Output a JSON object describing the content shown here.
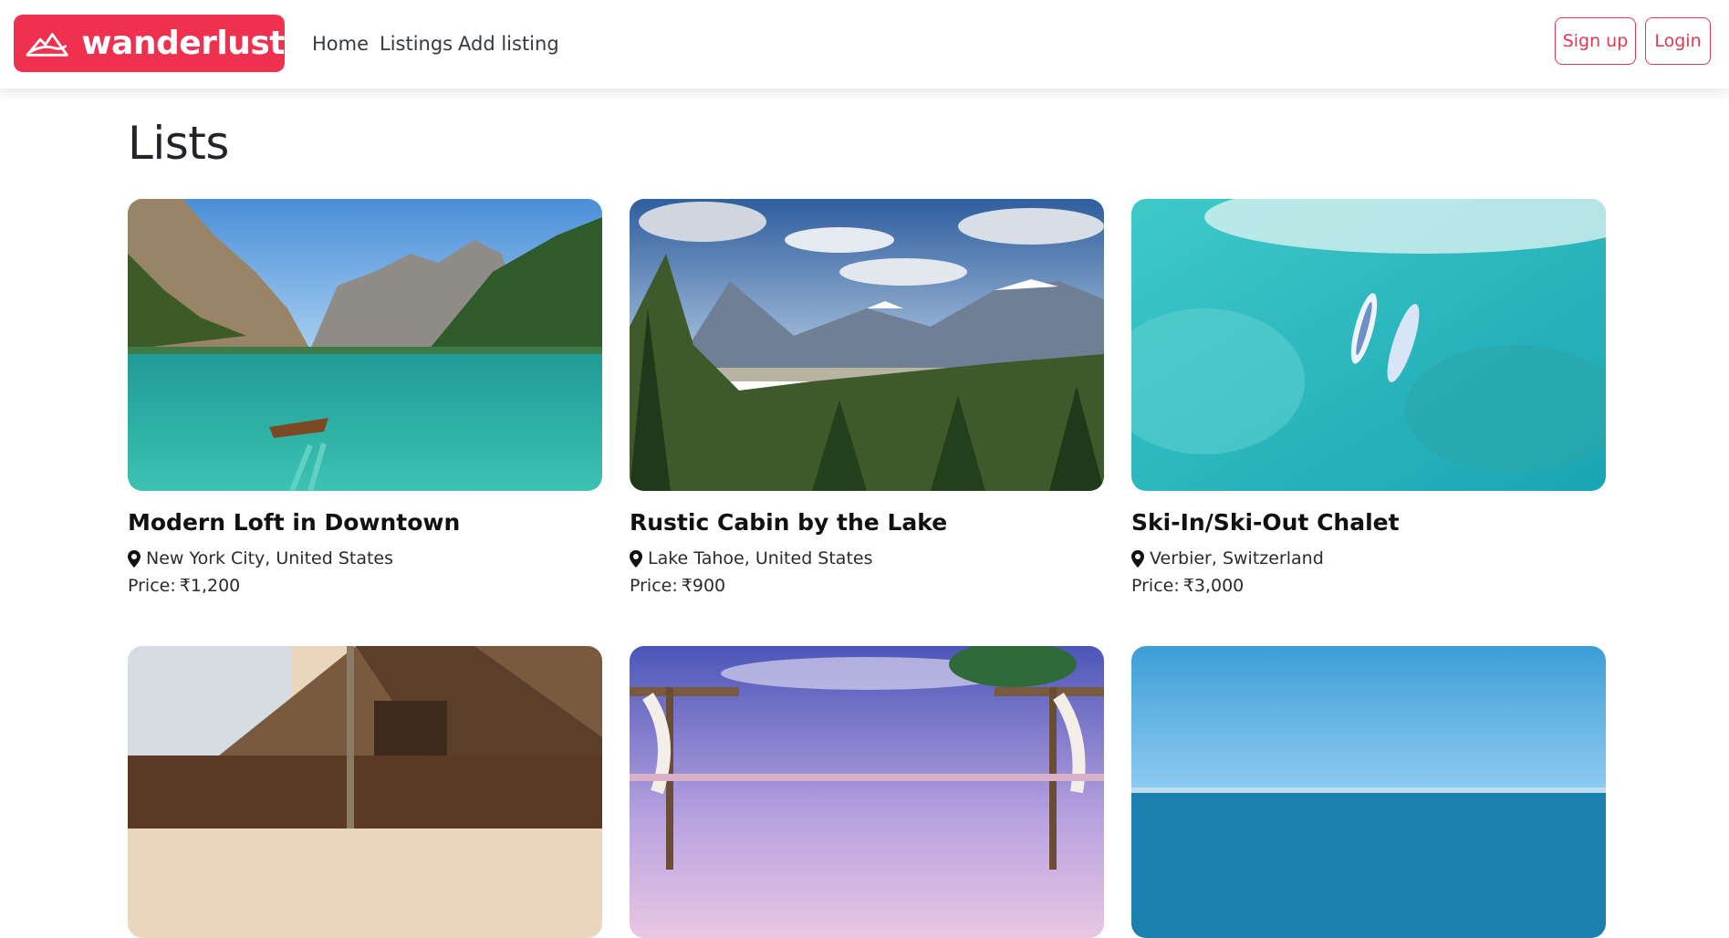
{
  "navbar": {
    "brand": "wanderlust",
    "links": [
      "Home",
      "Listings",
      "Add listing"
    ],
    "signup_label": "Sign up",
    "login_label": "Login",
    "accent_color": "#f0304f"
  },
  "page": {
    "title": "Lists"
  },
  "listings": [
    {
      "title": "Modern Loft in Downtown",
      "location": "New York City, United States",
      "price_label": "Price:",
      "price": "₹1,200",
      "image": "mountain-lake-with-rowboat"
    },
    {
      "title": "Rustic Cabin by the Lake",
      "location": "Lake Tahoe, United States",
      "price_label": "Price:",
      "price": "₹900",
      "image": "snowy-mountains-and-pine-forest"
    },
    {
      "title": "Ski-In/Ski-Out Chalet",
      "location": "Verbier, Switzerland",
      "price_label": "Price:",
      "price": "₹3,000",
      "image": "turquoise-sea-with-two-boats"
    },
    {
      "title": "",
      "location": "",
      "price_label": "",
      "price": "",
      "image": "wooden-resort-lodge"
    },
    {
      "title": "",
      "location": "",
      "price_label": "",
      "price": "",
      "image": "beach-cabanas-at-sunset"
    },
    {
      "title": "",
      "location": "",
      "price_label": "",
      "price": "",
      "image": "blue-ocean-and-sky"
    }
  ]
}
